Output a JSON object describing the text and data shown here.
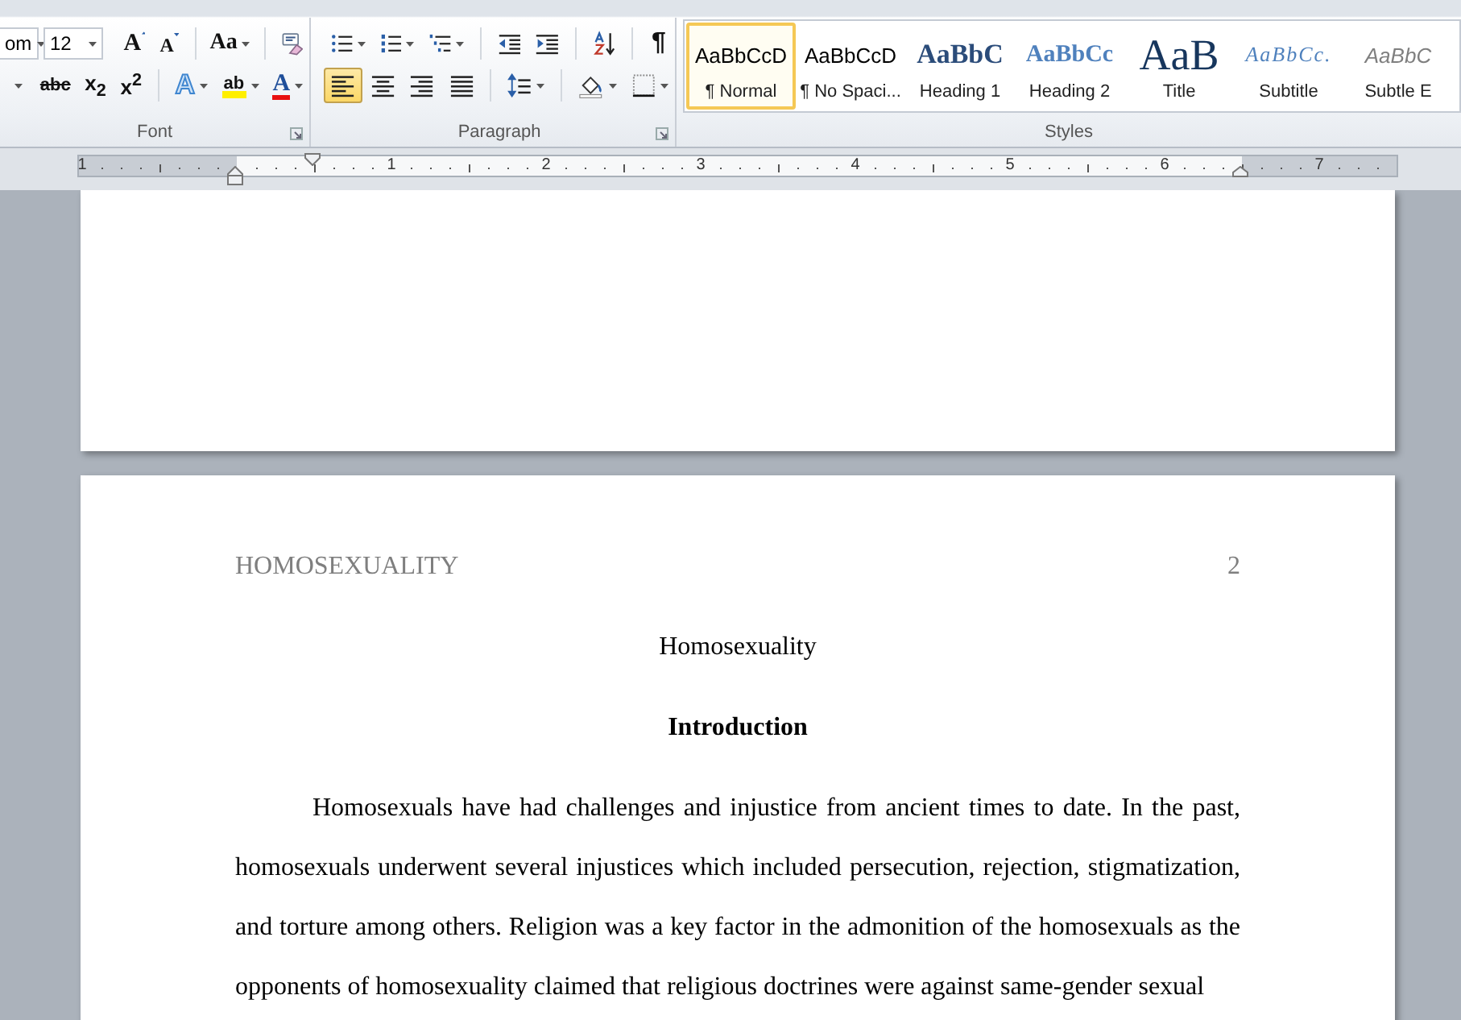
{
  "ribbon": {
    "font_group": {
      "label": "Font",
      "font_name": "om",
      "font_size": "12",
      "row1": [
        {
          "kind": "grow",
          "text": "A",
          "dropdown": false
        },
        {
          "kind": "shrink",
          "text": "A",
          "dropdown": false
        },
        {
          "kind": "change_case",
          "text": "Aa",
          "dropdown": true
        },
        {
          "kind": "clear_formatting",
          "dropdown": false
        }
      ],
      "row2": [
        {
          "kind": "underline_menu",
          "dropdown": true
        },
        {
          "kind": "strikethrough",
          "text": "abc",
          "dropdown": false
        },
        {
          "kind": "subscript",
          "text": "x$_{2}$",
          "dropdown": false
        },
        {
          "kind": "superscript",
          "text": "x$^{2}$",
          "dropdown": false
        },
        {
          "kind": "text_effects",
          "text": "A",
          "dropdown": true
        },
        {
          "kind": "highlight",
          "text": "ab",
          "dropdown": true
        },
        {
          "kind": "font_color",
          "text": "A",
          "dropdown": true
        }
      ]
    },
    "paragraph_group": {
      "label": "Paragraph",
      "row1": [
        {
          "kind": "bullets",
          "dropdown": true
        },
        {
          "kind": "numbering",
          "dropdown": true
        },
        {
          "kind": "multilevel",
          "dropdown": true
        },
        {
          "kind": "decrease_indent",
          "dropdown": false
        },
        {
          "kind": "increase_indent",
          "dropdown": false
        },
        {
          "kind": "sort",
          "dropdown": false
        },
        {
          "kind": "show_marks",
          "text": "¶",
          "dropdown": false
        }
      ],
      "alignment": [
        {
          "kind": "align_left",
          "selected": true
        },
        {
          "kind": "align_center",
          "selected": false
        },
        {
          "kind": "align_right",
          "selected": false
        },
        {
          "kind": "justify",
          "selected": false
        }
      ],
      "row2": [
        {
          "kind": "line_spacing",
          "dropdown": true
        },
        {
          "kind": "shading",
          "dropdown": true
        },
        {
          "kind": "borders",
          "dropdown": true
        }
      ]
    },
    "styles_group": {
      "label": "Styles",
      "styles": [
        {
          "kind": "normal",
          "preview": "AaBbCcD",
          "label": "¶ Normal",
          "selected": true
        },
        {
          "kind": "normal",
          "preview": "AaBbCcD",
          "label": "¶ No Spaci...",
          "selected": false
        },
        {
          "kind": "heading1",
          "preview": "AaBbC",
          "label": "Heading 1",
          "selected": false
        },
        {
          "kind": "heading2",
          "preview": "AaBbCc",
          "label": "Heading 2",
          "selected": false
        },
        {
          "kind": "title",
          "preview": "AaB",
          "label": "Title",
          "selected": false
        },
        {
          "kind": "subtitle",
          "preview": "AaBbCc.",
          "label": "Subtitle",
          "selected": false
        },
        {
          "kind": "subtle",
          "preview": "AaBbC",
          "label": "Subtle E",
          "selected": false
        }
      ]
    }
  },
  "ruler": {
    "labels": [
      "1",
      "1",
      "2",
      "3",
      "4",
      "5",
      "6",
      "7"
    ]
  },
  "document": {
    "header_title": "HOMOSEXUALITY",
    "page_number": "2",
    "title": "Homosexuality",
    "heading": "Introduction",
    "paragraph_lines": [
      "Homosexuals have had challenges and injustice from ancient times to date. In the past,",
      "homosexuals underwent several injustices which included persecution, rejection, stigmatization,",
      "and torture among others. Religion was a key factor in the admonition of the homosexuals as the",
      "opponents of homosexuality claimed that religious doctrines were against same-gender sexual"
    ]
  }
}
